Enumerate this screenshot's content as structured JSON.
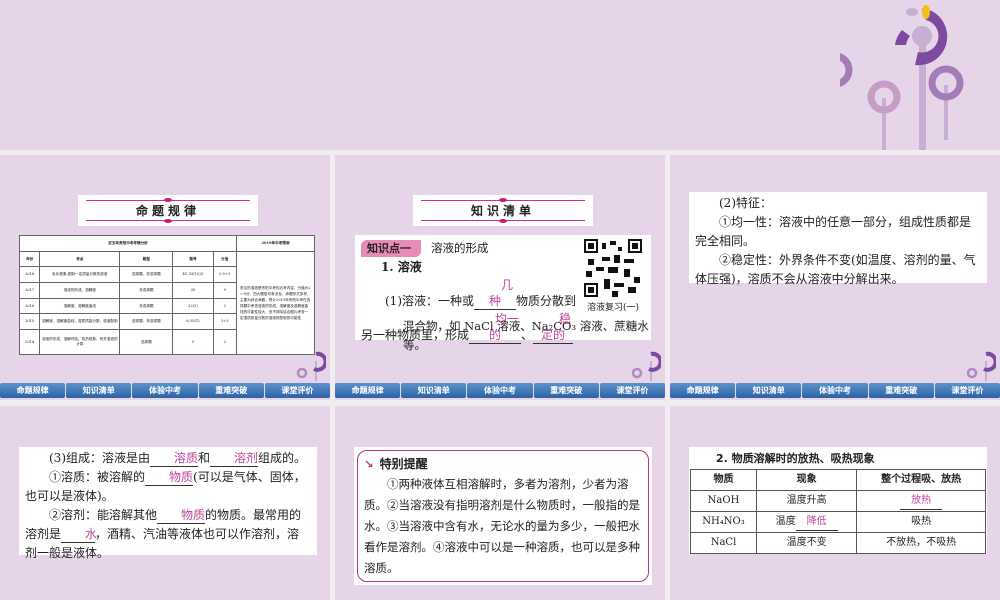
{
  "nav": [
    "命题规律",
    "知识清单",
    "体验中考",
    "重难突破",
    "课堂评价"
  ],
  "slide1": {
    "banner": "命题规律",
    "table": {
      "group_header": "近五年贵阳中考考情分析",
      "forecast_header": "2019年中考预测",
      "columns": [
        "年份",
        "考点",
        "题型",
        "题号",
        "分值"
      ],
      "rows": [
        [
          "2018",
          "乳化现象;配制一定质量分数的溶液",
          "选择题、非选择题",
          "4C;33(1)(2)",
          "0.5+3"
        ],
        [
          "2017",
          "溶液的形成、溶解度",
          "非选择题",
          "35",
          "9"
        ],
        [
          "2016",
          "溶解度、溶解度曲线",
          "非选择题",
          "32(3)",
          "2"
        ],
        [
          "2015",
          "溶解度、溶解度曲线、溶质质量分数、溶液配制",
          "选择题、非选择题",
          "6;35(1)",
          "2+3"
        ],
        [
          "2014",
          "溶液的形成、溶解时吸、放热现象、有关溶液的计算",
          "选择题",
          "5",
          "2"
        ]
      ],
      "forecast": "常见的溶液是贵阳中考的必考内容，分值为2～9分，四大题型均有涉及，命题形式多样，主要为综合命题。预计2019年贵阳中考在选择题中考查溶液的形成、溶解度及溶解度曲线的可能性较大，但不排除结合图片考查一定溶质质量分数的溶液的配制的可能性"
    }
  },
  "slide2": {
    "banner": "知识清单",
    "tag": "知识点一",
    "tag_title": "溶液的形成",
    "heading": "1. 溶液",
    "t1": "(1)溶液：一种或",
    "b1": "几种",
    "t2": "物质分散到另一种物质里，形成",
    "b2": "均一的",
    "t3": "、",
    "b3": "稳定的",
    "t4": "混合物，如 NaCl 溶液、Na₂CO₃ 溶液、蔗糖水等。",
    "qr_caption": "溶液复习(一)"
  },
  "slide3": {
    "lines": [
      "(2)特征：",
      "①均一性：溶液中的任意一部分，组成性质都是完全相同。",
      "②稳定性：外界条件不变(如温度、溶剂的量、气体压强)，溶质不会从溶液中分解出来。"
    ]
  },
  "slide4": {
    "a1": "(3)组成：溶液是由",
    "b1": "溶质",
    "a2": "和",
    "b2": "溶剂",
    "a3": "组成的。",
    "c1": "①溶质：被溶解的",
    "b3": "物质",
    "c2": "(可以是气体、固体，也可以是液体)。",
    "d1": "②溶剂：能溶解其他",
    "b4": "物质",
    "d2": "的物质。最常用的溶剂是",
    "b5": "水",
    "d3": "，酒精、汽油等液体也可以作溶剂，溶剂一般是液体。"
  },
  "slide5": {
    "title": "特别提醒",
    "body": "①两种液体互相溶解时，多者为溶剂，少者为溶质。②当溶液没有指明溶剂是什么物质时，一般指的是水。③当溶液中含有水，无论水的量为多少，一般把水看作是溶剂。④溶液中可以是一种溶质，也可以是多种溶质。"
  },
  "slide6": {
    "heading": "2. 物质溶解时的放热、吸热现象",
    "columns": [
      "物质",
      "现象",
      "整个过程吸、放热"
    ],
    "rows": [
      {
        "substance": "NaOH",
        "phenomenon": "温度升高",
        "heat": "放热",
        "heat_blank": true
      },
      {
        "substance": "NH₄NO₃",
        "phenomenon_prefix": "温度",
        "phenomenon_blank": "降低",
        "heat": "吸热"
      },
      {
        "substance": "NaCl",
        "phenomenon": "温度不变",
        "heat": "不放热，不吸热"
      }
    ]
  }
}
